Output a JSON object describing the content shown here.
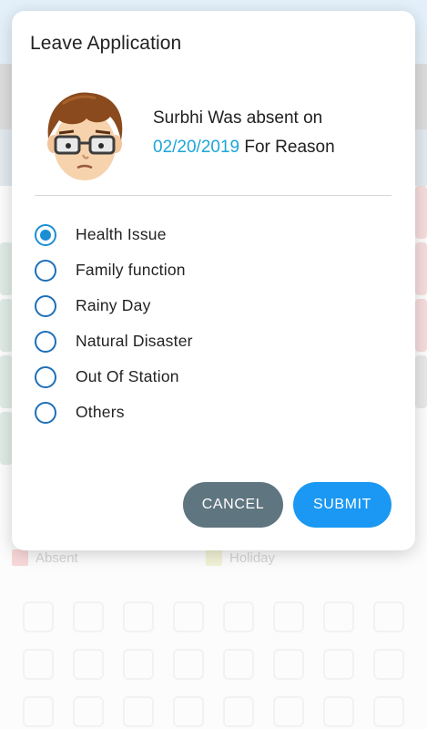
{
  "dialog": {
    "title": "Leave Application",
    "message_prefix": "Surbhi Was absent on",
    "date": "02/20/2019",
    "message_suffix": "For Reason",
    "options": [
      {
        "label": "Health Issue",
        "checked": true
      },
      {
        "label": "Family function",
        "checked": false
      },
      {
        "label": "Rainy Day",
        "checked": false
      },
      {
        "label": "Natural Disaster",
        "checked": false
      },
      {
        "label": "Out Of Station",
        "checked": false
      },
      {
        "label": "Others",
        "checked": false
      }
    ],
    "cancel_label": "CANCEL",
    "submit_label": "SUBMIT"
  },
  "background": {
    "legend": [
      {
        "label": "Absent",
        "color": "#f4c4c4"
      },
      {
        "label": "Holiday",
        "color": "#ecebc0"
      }
    ]
  },
  "colors": {
    "accent": "#1b8fd6",
    "date_text": "#1ca6d8",
    "cancel_button": "#5f7580",
    "submit_button": "#1a98f3"
  }
}
